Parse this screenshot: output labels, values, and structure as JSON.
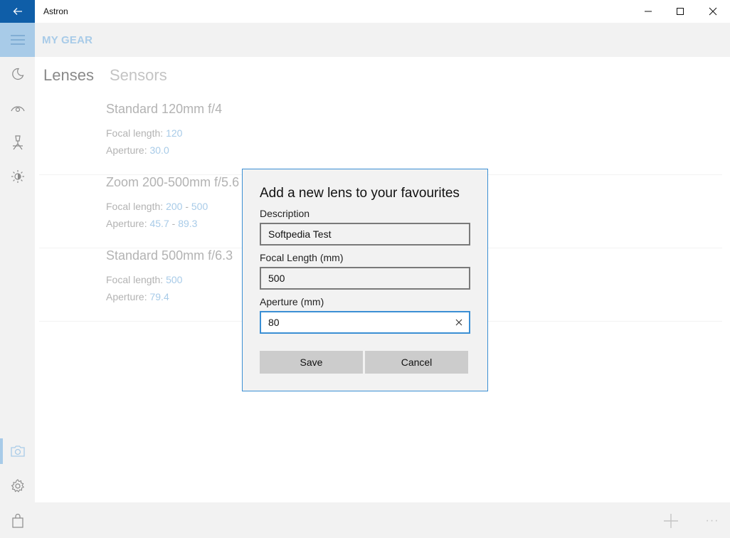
{
  "window": {
    "title": "Astron"
  },
  "icons": {
    "back": "back-arrow-icon",
    "minimize": "minimize-icon",
    "maximize": "maximize-icon",
    "close": "close-icon",
    "hamburger": "hamburger-icon",
    "moon": "moon-icon",
    "eye": "eye-icon",
    "telescope": "telescope-icon",
    "brightness": "brightness-icon",
    "camera": "camera-icon",
    "settings": "gear-icon",
    "store": "shopping-bag-icon",
    "add": "plus-icon",
    "more": "more-icon",
    "clear": "clear-x-icon"
  },
  "header": {
    "title": "MY GEAR"
  },
  "tabs": {
    "lenses": "Lenses",
    "sensors": "Sensors"
  },
  "lenses": [
    {
      "name": "Standard 120mm f/4",
      "focal_label": "Focal length:",
      "focal": "120",
      "focal_max": "",
      "aperture_label": "Aperture:",
      "aperture": "30.0",
      "aperture_max": ""
    },
    {
      "name": "Zoom 200-500mm f/5.6",
      "focal_label": "Focal length:",
      "focal": "200",
      "focal_max": "500",
      "aperture_label": "Aperture:",
      "aperture": "45.7",
      "aperture_max": "89.3",
      "range_sep": "-"
    },
    {
      "name": "Standard 500mm f/6.3",
      "focal_label": "Focal length:",
      "focal": "500",
      "focal_max": "",
      "aperture_label": "Aperture:",
      "aperture": "79.4",
      "aperture_max": ""
    }
  ],
  "bottombar": {
    "more": "···"
  },
  "dialog": {
    "title": "Add a new lens to your favourites",
    "description_label": "Description",
    "description_value": "Softpedia Test",
    "focal_label": "Focal Length (mm)",
    "focal_value": "500",
    "aperture_label": "Aperture (mm)",
    "aperture_value": "80",
    "save": "Save",
    "cancel": "Cancel"
  },
  "colors": {
    "accent": "#0f5ea8",
    "light_accent": "#a8cbe8",
    "focus_border": "#3b8fd4",
    "panel_bg": "#f2f2f2",
    "button_bg": "#cccccc"
  }
}
